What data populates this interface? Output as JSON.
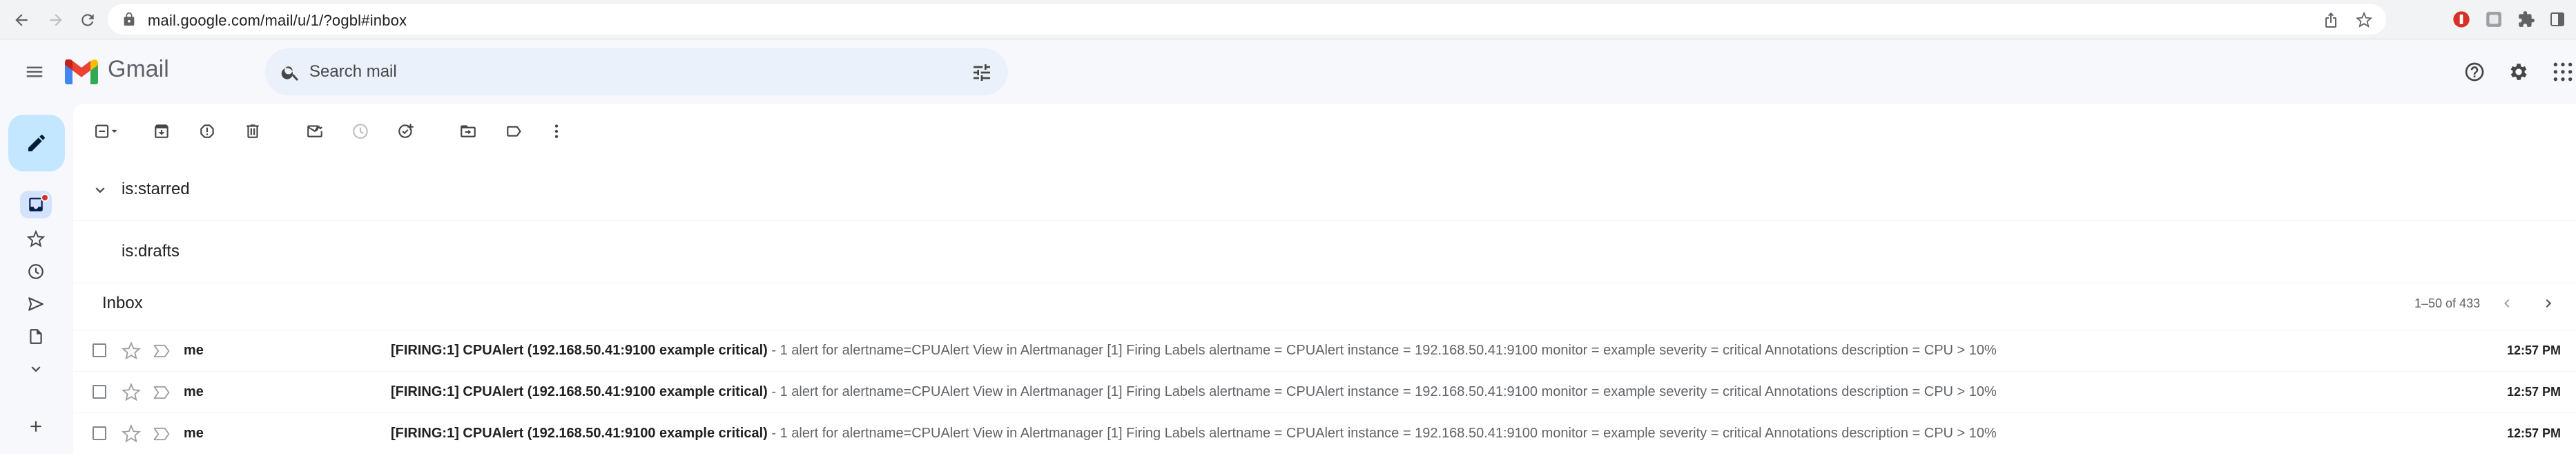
{
  "browser": {
    "url": "mail.google.com/mail/u/1/?ogbl#inbox"
  },
  "app": {
    "brand": "Gmail",
    "accent": "#c2e7ff"
  },
  "search": {
    "placeholder": "Search mail"
  },
  "sections": [
    {
      "title": "is:starred"
    },
    {
      "title": "is:drafts"
    }
  ],
  "inbox": {
    "title": "Inbox",
    "pagination": "1–50 of 433"
  },
  "emails": [
    {
      "sender": "me",
      "subject": "[FIRING:1] CPUAlert (192.168.50.41:9100 example critical)",
      "snippet": " - 1 alert for alertname=CPUAlert View in Alertmanager [1] Firing Labels alertname = CPUAlert instance = 192.168.50.41:9100 monitor = example severity = critical Annotations description = CPU > 10%",
      "time": "12:57 PM"
    },
    {
      "sender": "me",
      "subject": "[FIRING:1] CPUAlert (192.168.50.41:9100 example critical)",
      "snippet": " - 1 alert for alertname=CPUAlert View in Alertmanager [1] Firing Labels alertname = CPUAlert instance = 192.168.50.41:9100 monitor = example severity = critical Annotations description = CPU > 10%",
      "time": "12:57 PM"
    },
    {
      "sender": "me",
      "subject": "[FIRING:1] CPUAlert (192.168.50.41:9100 example critical)",
      "snippet": " - 1 alert for alertname=CPUAlert View in Alertmanager [1] Firing Labels alertname = CPUAlert instance = 192.168.50.41:9100 monitor = example severity = critical Annotations description = CPU > 10%",
      "time": "12:57 PM"
    }
  ]
}
